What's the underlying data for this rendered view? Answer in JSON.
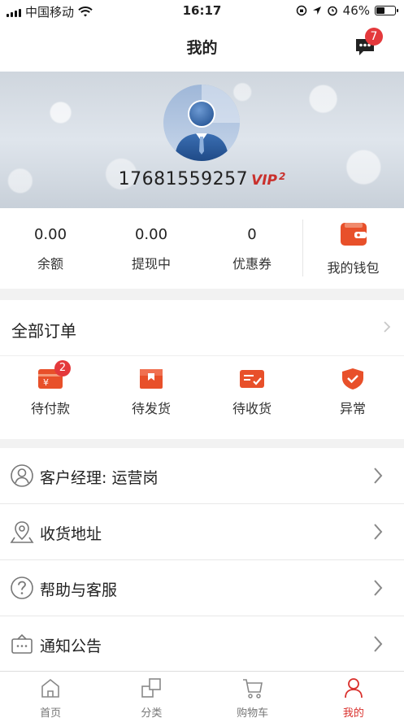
{
  "status": {
    "carrier": "中国移动",
    "time": "16:17",
    "battery": "46%",
    "battery_level": 0.46
  },
  "nav": {
    "title": "我的",
    "message_badge": "7"
  },
  "profile": {
    "phone": "17681559257",
    "vip_label": "VIP",
    "vip_level": "2"
  },
  "stats": [
    {
      "value": "0.00",
      "label": "余额"
    },
    {
      "value": "0.00",
      "label": "提现中"
    },
    {
      "value": "0",
      "label": "优惠券"
    }
  ],
  "wallet": {
    "label": "我的钱包",
    "icon": "wallet-icon"
  },
  "orders": {
    "title": "全部订单",
    "items": [
      {
        "label": "待付款",
        "icon": "pending-payment-icon",
        "badge": "2"
      },
      {
        "label": "待发货",
        "icon": "pending-shipment-icon"
      },
      {
        "label": "待收货",
        "icon": "pending-receipt-icon"
      },
      {
        "label": "异常",
        "icon": "exception-shield-icon"
      }
    ]
  },
  "menu": [
    {
      "label": "客户经理: 运营岗",
      "icon": "person-icon"
    },
    {
      "label": "收货地址",
      "icon": "location-pin-icon"
    },
    {
      "label": "帮助与客服",
      "icon": "help-icon"
    },
    {
      "label": "通知公告",
      "icon": "notice-icon"
    }
  ],
  "tabs": [
    {
      "label": "首页",
      "icon": "home-icon"
    },
    {
      "label": "分类",
      "icon": "category-icon"
    },
    {
      "label": "购物车",
      "icon": "cart-icon"
    },
    {
      "label": "我的",
      "icon": "user-icon",
      "active": true
    }
  ],
  "colors": {
    "accent": "#e8502a",
    "badge": "#e4393c",
    "active_tab": "#d9302c"
  }
}
